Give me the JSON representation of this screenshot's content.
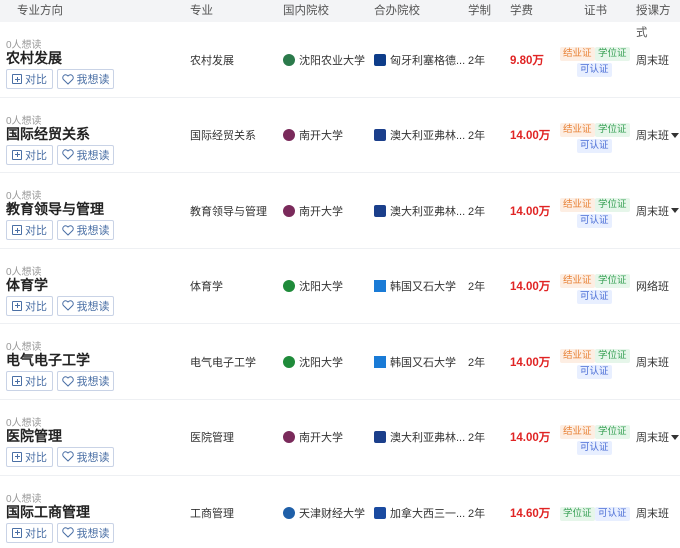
{
  "header": {
    "direction": "专业方向",
    "major": "专业",
    "domestic": "国内院校",
    "partner": "合办院校",
    "years": "学制",
    "fee": "学费",
    "certs": "证书",
    "mode": "授课方式"
  },
  "buttons": {
    "compare": "对比",
    "want": "我想读"
  },
  "rows": [
    {
      "reads": "0人想读",
      "title": "农村发展",
      "major": "农村发展",
      "domestic": "沈阳农业大学",
      "partner": "匈牙利塞格德...",
      "years": "2年",
      "fee": "9.80万",
      "certs": [
        "结业证",
        "学位证",
        "可认证"
      ],
      "mode": "周末班",
      "dropdown": false
    },
    {
      "reads": "0人想读",
      "title": "国际经贸关系",
      "major": "国际经贸关系",
      "domestic": "南开大学",
      "partner": "澳大利亚弗林...",
      "years": "2年",
      "fee": "14.00万",
      "certs": [
        "结业证",
        "学位证",
        "可认证"
      ],
      "mode": "周末班",
      "dropdown": true
    },
    {
      "reads": "0人想读",
      "title": "教育领导与管理",
      "major": "教育领导与管理",
      "domestic": "南开大学",
      "partner": "澳大利亚弗林...",
      "years": "2年",
      "fee": "14.00万",
      "certs": [
        "结业证",
        "学位证",
        "可认证"
      ],
      "mode": "周末班",
      "dropdown": true
    },
    {
      "reads": "0人想读",
      "title": "体育学",
      "major": "体育学",
      "domestic": "沈阳大学",
      "partner": "韩国又石大学",
      "years": "2年",
      "fee": "14.00万",
      "certs": [
        "结业证",
        "学位证",
        "可认证"
      ],
      "mode": "网络班",
      "dropdown": false
    },
    {
      "reads": "0人想读",
      "title": "电气电子工学",
      "major": "电气电子工学",
      "domestic": "沈阳大学",
      "partner": "韩国又石大学",
      "years": "2年",
      "fee": "14.00万",
      "certs": [
        "结业证",
        "学位证",
        "可认证"
      ],
      "mode": "周末班",
      "dropdown": false
    },
    {
      "reads": "0人想读",
      "title": "医院管理",
      "major": "医院管理",
      "domestic": "南开大学",
      "partner": "澳大利亚弗林...",
      "years": "2年",
      "fee": "14.00万",
      "certs": [
        "结业证",
        "学位证",
        "可认证"
      ],
      "mode": "周末班",
      "dropdown": true
    },
    {
      "reads": "0人想读",
      "title": "国际工商管理",
      "major": "工商管理",
      "domestic": "天津财经大学",
      "partner": "加拿大西三一...",
      "years": "2年",
      "fee": "14.60万",
      "certs": [
        "学位证",
        "可认证"
      ],
      "mode": "周末班",
      "dropdown": false
    }
  ],
  "colors": {
    "fee": "#e02424",
    "button": "#4a6fa5",
    "header_bg": "#f3f4f6"
  }
}
